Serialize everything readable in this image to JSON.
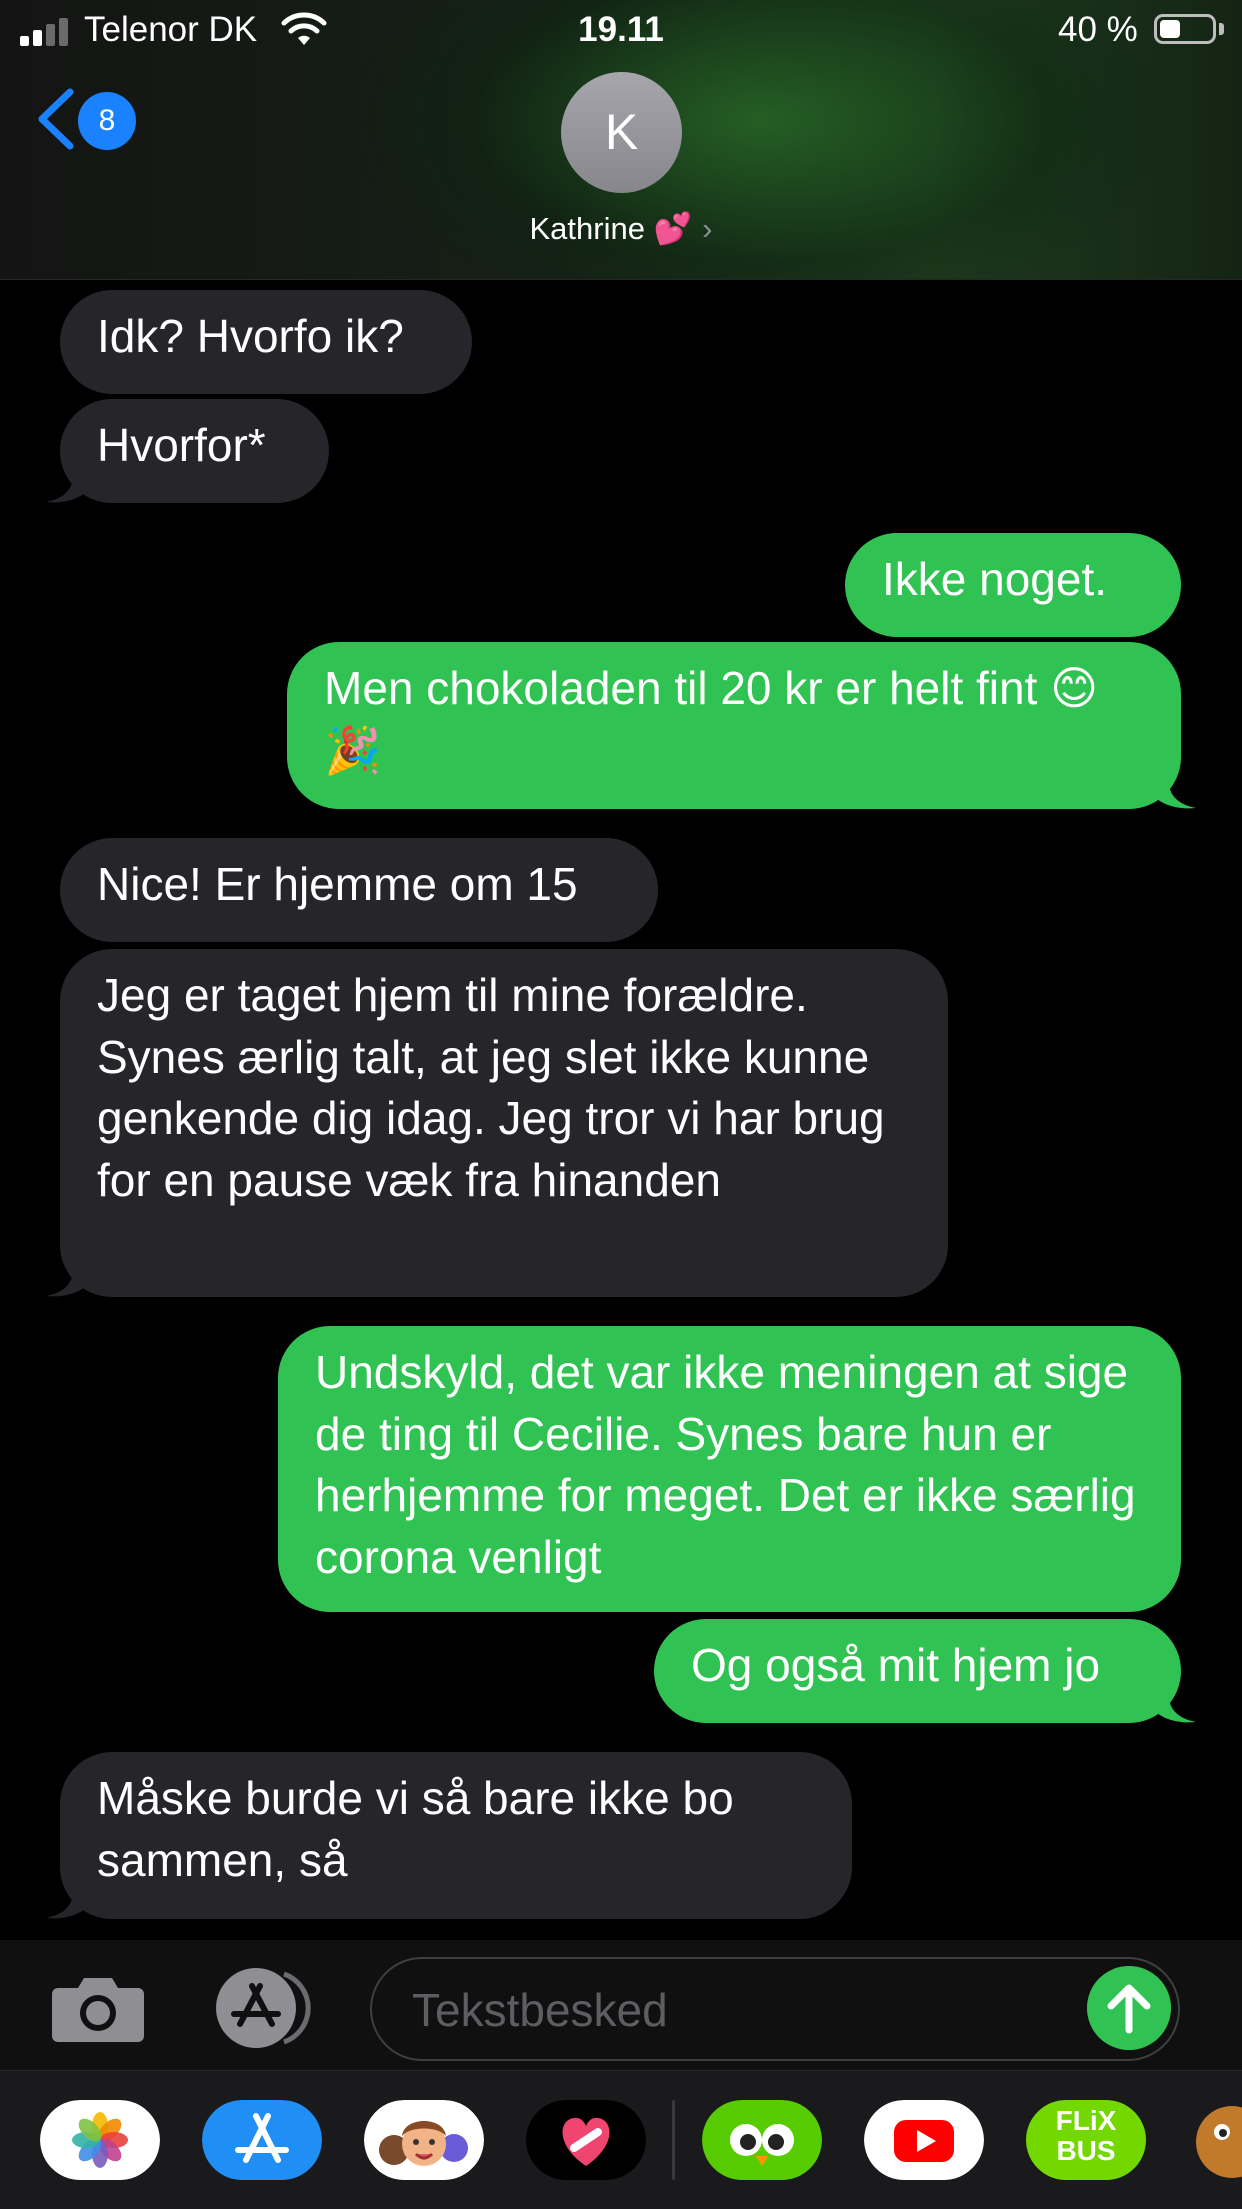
{
  "status_bar": {
    "carrier": "Telenor DK",
    "time": "19.11",
    "battery_percent_label": "40 %",
    "battery_level": 0.4,
    "signal_bars": 2
  },
  "nav": {
    "back_count": "8",
    "avatar_initial": "K",
    "contact_name": "Kathrine 💕",
    "chevron": "›"
  },
  "messages": [
    {
      "dir": "in",
      "text": "Idk? Hvorfo ik?"
    },
    {
      "dir": "in",
      "text": "Hvorfor*"
    },
    {
      "dir": "out",
      "text": "Ikke noget."
    },
    {
      "dir": "out",
      "text": "Men chokoladen til 20 kr er helt fint 😊🎉"
    },
    {
      "dir": "in",
      "text": "Nice! Er hjemme om 15"
    },
    {
      "dir": "in",
      "text": "Jeg er taget hjem til mine forældre. Synes ærlig talt, at jeg slet ikke kunne genkende dig idag. Jeg tror vi har brug for en pause væk fra hinanden"
    },
    {
      "dir": "out",
      "text": "Undskyld, det var ikke meningen at sige de ting til Cecilie. Synes bare hun er herhjemme for meget. Det er ikke særlig corona venligt"
    },
    {
      "dir": "out",
      "text": "Og også mit hjem jo"
    },
    {
      "dir": "in",
      "text": "Måske burde vi så bare ikke bo sammen, så"
    }
  ],
  "composer": {
    "placeholder": "Tekstbesked",
    "camera_icon": "camera-icon",
    "apps_icon": "app-store-icon",
    "send_icon": "arrow-up-icon"
  },
  "app_drawer": [
    {
      "name": "photos",
      "icon": "photos-icon",
      "color": "#ffffff"
    },
    {
      "name": "app-store",
      "icon": "app-store-icon",
      "color": "#1f8ef5"
    },
    {
      "name": "memoji",
      "icon": "memoji-icon",
      "color": "#ffffff"
    },
    {
      "name": "digital-touch",
      "icon": "heart-touch-icon",
      "color": "#000000"
    },
    {
      "name": "duolingo",
      "icon": "owl-icon",
      "color": "#58cc02"
    },
    {
      "name": "youtube",
      "icon": "youtube-icon",
      "color": "#ffffff"
    },
    {
      "name": "flixbus",
      "icon": "flixbus-icon",
      "color": "#73d700",
      "label": "FLiX BUS"
    },
    {
      "name": "sticker-app",
      "icon": "monster-icon",
      "color": "#c07a2a"
    }
  ],
  "colors": {
    "outgoing_bubble": "#30c252",
    "incoming_bubble": "#26252a",
    "accent_blue": "#1a82ff"
  }
}
